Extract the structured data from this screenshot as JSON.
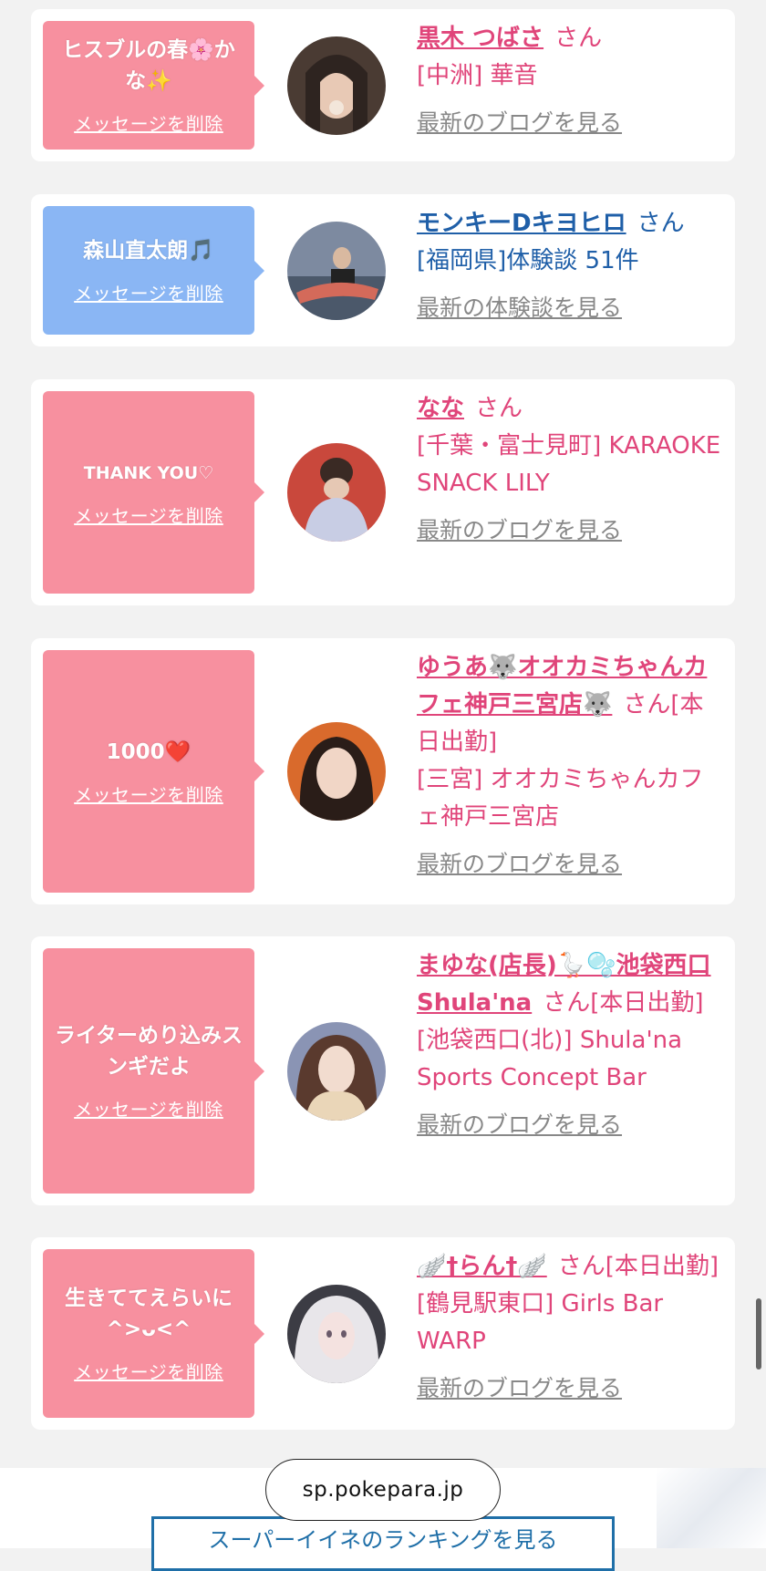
{
  "common": {
    "delete_label": "メッセージを削除",
    "san": "さん"
  },
  "colors": {
    "pink_bubble": "#f7909f",
    "blue_bubble": "#8ab6f4",
    "pink_text": "#e0457a",
    "blue_text": "#1f5fa8"
  },
  "cards": [
    {
      "message": "ヒスブルの春🌸かな✨",
      "name": "黒木 つばさ",
      "suffix": "",
      "shop": "[中洲] 華音",
      "link": "最新のブログを見る"
    },
    {
      "message": "森山直太朗🎵",
      "name": "モンキーDキヨヒロ",
      "suffix": "",
      "shop": "[福岡県]体験談 51件",
      "link": "最新の体験談を見る"
    },
    {
      "message": "THANK YOU♡",
      "name": "なな",
      "suffix": "",
      "shop": "[千葉・富士見町] KARAOKE SNACK LILY",
      "link": "最新のブログを見る"
    },
    {
      "message": "1000❤️",
      "name": "ゆうあ🐺オオカミちゃんカフェ神戸三宮店🐺",
      "suffix": "[本日出勤]",
      "shop": "[三宮] オオカミちゃんカフェ神戸三宮店",
      "link": "最新のブログを見る"
    },
    {
      "message": "ライターめり込みスンギだよ",
      "name": "まゆな(店長)🪿🫧池袋西口Shula'na",
      "suffix": "[本日出勤]",
      "shop": "[池袋西口(北)] Shula'na Sports Concept Bar",
      "link": "最新のブログを見る"
    },
    {
      "message": "生きててえらいに^>ᴗ<^",
      "name": "🪽†らん†🪽",
      "suffix": "[本日出勤]",
      "shop": "[鶴見駅東口] Girls Bar WARP",
      "link": "最新のブログを見る"
    }
  ],
  "footer": {
    "url": "sp.pokepara.jp",
    "ranking_button": "スーパーイイネのランキングを見る"
  }
}
